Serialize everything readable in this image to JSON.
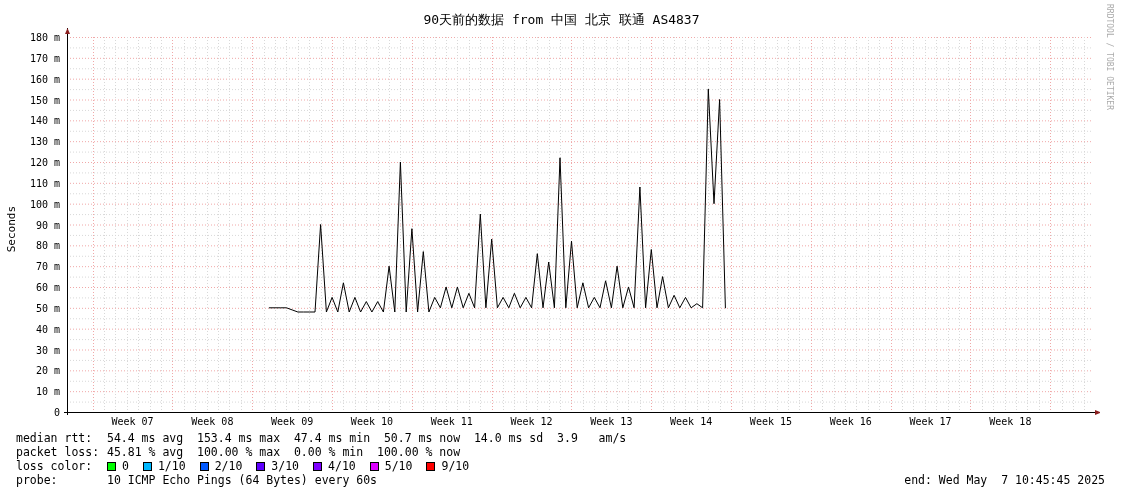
{
  "chart": {
    "chart_data": {
      "type": "line",
      "title": "90天前的数据 from 中国 北京 联通 AS4837",
      "ylabel": "Seconds",
      "categories": [
        null,
        null,
        null,
        null,
        null,
        null,
        null,
        null,
        null,
        null,
        null,
        "Week 07",
        null,
        null,
        null,
        null,
        null,
        null,
        null,
        null,
        null,
        null,
        null,
        null,
        null,
        "Week 08",
        null,
        null,
        null,
        null,
        null,
        null,
        null,
        null,
        null,
        null,
        null,
        null,
        null,
        "Week 09",
        null,
        null,
        null,
        null,
        null,
        null,
        null,
        null,
        null,
        null,
        null,
        null,
        null,
        "Week 10",
        null,
        null,
        null,
        null,
        null,
        null,
        null,
        null,
        null,
        null,
        null,
        null,
        null,
        "Week 11",
        null,
        null,
        null,
        null,
        null,
        null,
        null,
        null,
        null,
        null,
        null,
        null,
        null,
        "Week 12",
        null,
        null,
        null,
        null,
        null,
        null,
        null,
        null,
        null,
        null,
        null,
        null,
        null,
        "Week 13",
        null,
        null,
        null,
        null,
        null,
        null,
        null,
        null,
        null,
        null,
        null,
        null,
        null,
        "Week 14",
        null,
        null,
        null,
        null,
        null,
        null,
        null,
        null,
        null,
        null,
        null,
        null,
        null,
        "Week 15",
        null,
        null,
        null,
        null,
        null,
        null,
        null,
        null,
        null,
        null,
        null,
        null,
        null,
        "Week 16",
        null,
        null,
        null,
        null,
        null,
        null,
        null,
        null,
        null,
        null,
        null,
        null,
        null,
        "Week 17",
        null,
        null,
        null,
        null,
        null,
        null,
        null,
        null,
        null,
        null,
        null,
        null,
        null,
        "Week 18",
        null,
        null,
        null,
        null,
        null,
        null,
        null,
        null,
        null,
        null,
        null,
        null,
        null,
        null
      ],
      "series": [
        {
          "color": "#000000",
          "values": [
            null,
            null,
            null,
            null,
            null,
            null,
            null,
            null,
            null,
            null,
            null,
            null,
            null,
            null,
            null,
            null,
            null,
            null,
            null,
            null,
            null,
            null,
            null,
            null,
            null,
            null,
            null,
            null,
            null,
            null,
            null,
            null,
            null,
            null,
            null,
            50,
            50,
            50,
            50,
            49,
            48,
            48,
            48,
            48,
            90,
            48,
            55,
            48,
            62,
            48,
            55,
            48,
            53,
            48,
            53,
            48,
            70,
            48,
            120,
            48,
            88,
            48,
            77,
            48,
            55,
            50,
            60,
            50,
            60,
            50,
            57,
            50,
            95,
            50,
            83,
            50,
            55,
            50,
            57,
            50,
            55,
            50,
            76,
            50,
            72,
            50,
            122,
            50,
            82,
            50,
            62,
            50,
            55,
            50,
            63,
            50,
            70,
            50,
            60,
            50,
            108,
            50,
            78,
            50,
            65,
            50,
            56,
            50,
            55,
            50,
            52,
            50,
            155,
            100,
            150,
            50,
            null,
            null,
            null,
            null,
            null,
            null,
            null,
            null,
            null,
            null,
            null,
            null,
            null,
            null,
            null,
            null,
            null,
            null,
            null,
            null,
            null,
            null,
            null,
            null,
            null,
            null,
            null,
            null,
            null,
            null,
            null,
            null,
            null,
            null,
            null,
            null,
            null,
            null,
            null,
            null,
            null,
            null,
            null,
            null,
            null,
            null,
            null,
            null,
            null,
            null,
            null,
            null,
            null,
            null,
            null,
            null,
            null,
            null,
            null,
            null,
            null,
            null,
            null,
            null
          ]
        }
      ],
      "grid": true,
      "ylim": [
        0,
        180
      ],
      "yticks": [
        {
          "value": 0,
          "label": "0"
        },
        {
          "value": 10,
          "label": "10 m"
        },
        {
          "value": 20,
          "label": "20 m"
        },
        {
          "value": 30,
          "label": "30 m"
        },
        {
          "value": 40,
          "label": "40 m"
        },
        {
          "value": 50,
          "label": "50 m"
        },
        {
          "value": 60,
          "label": "60 m"
        },
        {
          "value": 70,
          "label": "70 m"
        },
        {
          "value": 80,
          "label": "80 m"
        },
        {
          "value": 90,
          "label": "90 m"
        },
        {
          "value": 100,
          "label": "100 m"
        },
        {
          "value": 110,
          "label": "110 m"
        },
        {
          "value": 120,
          "label": "120 m"
        },
        {
          "value": 130,
          "label": "130 m"
        },
        {
          "value": 140,
          "label": "140 m"
        },
        {
          "value": 150,
          "label": "150 m"
        },
        {
          "value": 160,
          "label": "160 m"
        },
        {
          "value": 170,
          "label": "170 m"
        },
        {
          "value": 180,
          "label": "180 m"
        }
      ]
    }
  },
  "legend": {
    "rows": [
      {
        "label": "median rtt:",
        "value": "54.4 ms avg  153.4 ms max  47.4 ms min  50.7 ms now  14.0 ms sd  3.9   am/s"
      },
      {
        "label": "packet loss:",
        "value": "45.81 % avg  100.00 % max  0.00 % min  100.00 % now"
      }
    ],
    "loss_color": {
      "label": "loss color:",
      "items": [
        {
          "label": "0",
          "color": "#00ff00"
        },
        {
          "label": "1/10",
          "color": "#00b8ff"
        },
        {
          "label": "2/10",
          "color": "#0059ff"
        },
        {
          "label": "3/10",
          "color": "#5e00ff"
        },
        {
          "label": "4/10",
          "color": "#7e00ff"
        },
        {
          "label": "5/10",
          "color": "#dd00ff"
        },
        {
          "label": "9/10",
          "color": "#ff0000"
        }
      ]
    },
    "probe": {
      "label": "probe:",
      "value": "10 ICMP Echo Pings (64 Bytes) every 60s"
    },
    "end": "end: Wed May  7 10:45:45 2025"
  },
  "credit": "RRDTOOL / TOBI OETIKER"
}
